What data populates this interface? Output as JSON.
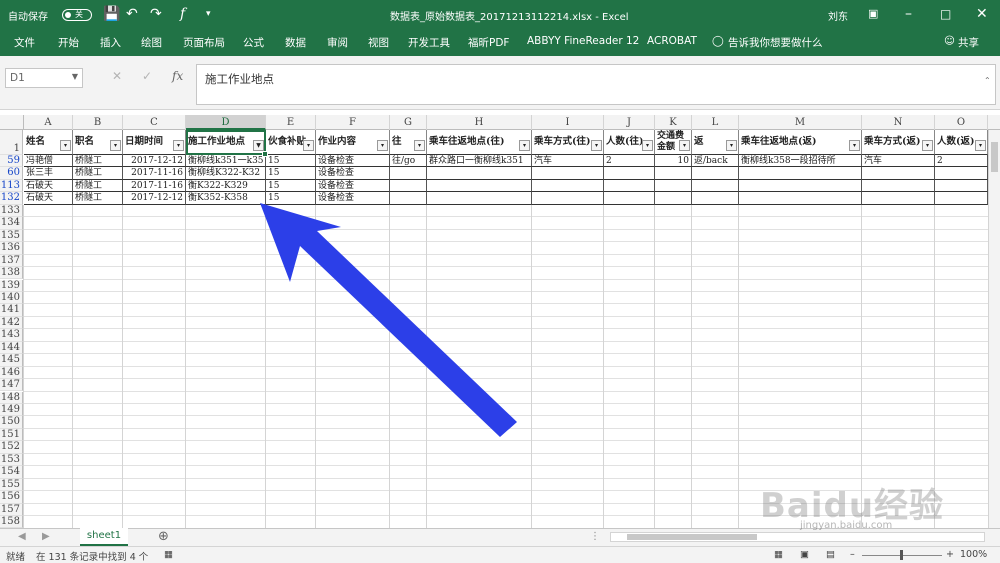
{
  "titlebar": {
    "autosave": "自动保存",
    "autosave_state": "关",
    "title": "数据表_原始数据表_20171213112214.xlsx  -  Excel",
    "user": "刘东"
  },
  "ribbon": {
    "tabs": [
      "文件",
      "开始",
      "插入",
      "绘图",
      "页面布局",
      "公式",
      "数据",
      "审阅",
      "视图",
      "开发工具",
      "福昕PDF",
      "ABBYY FineReader 12",
      "ACROBAT"
    ],
    "tell_me": "告诉我你想要做什么",
    "share": "共享"
  },
  "formula_bar": {
    "name_box": "D1",
    "fx": "fx",
    "content": "施工作业地点"
  },
  "columns": [
    "A",
    "B",
    "C",
    "D",
    "E",
    "F",
    "G",
    "H",
    "I",
    "J",
    "K",
    "L",
    "M",
    "N",
    "O"
  ],
  "header_row_number": "1",
  "headers": [
    "姓名",
    "职名",
    "日期时间",
    "施工作业地点",
    "伙食补贴",
    "作业内容",
    "往",
    "乘车往返地点(往)",
    "乘车方式(往)",
    "人数(往)",
    "交通费金额",
    "返",
    "乘车往返地点(返)",
    "乘车方式(返)",
    "人数(返)"
  ],
  "rows": [
    {
      "num": "59",
      "cells": [
        "冯艳僧",
        "桥隧工",
        "2017-12-12",
        "衡柳线k351一k35",
        "15",
        "设备检查",
        "往/go",
        "群众路口一衡柳线k351",
        "汽车",
        "2",
        "10",
        "返/back",
        "衡柳线k358一段招待所",
        "汽车",
        "2"
      ]
    },
    {
      "num": "60",
      "cells": [
        "张三丰",
        "桥隧工",
        "2017-11-16",
        "衡柳线K322-K32",
        "15",
        "设备检查",
        "",
        "",
        "",
        "",
        "",
        "",
        "",
        "",
        ""
      ]
    },
    {
      "num": "113",
      "cells": [
        "石破天",
        "桥隧工",
        "2017-11-16",
        "衡K322-K329",
        "15",
        "设备检查",
        "",
        "",
        "",
        "",
        "",
        "",
        "",
        "",
        ""
      ]
    },
    {
      "num": "132",
      "cells": [
        "石破天",
        "桥隧工",
        "2017-12-12",
        "衡K352-K358",
        "15",
        "设备检查",
        "",
        "",
        "",
        "",
        "",
        "",
        "",
        "",
        ""
      ]
    }
  ],
  "empty_rows": [
    "133",
    "134",
    "135",
    "136",
    "137",
    "138",
    "139",
    "140",
    "141",
    "142",
    "143",
    "144",
    "145",
    "146",
    "147",
    "148",
    "149",
    "150",
    "151",
    "152",
    "153",
    "154",
    "155",
    "156",
    "157",
    "158"
  ],
  "sheet_tab": "sheet1",
  "status": {
    "mode": "就绪",
    "message": "在 131 条记录中找到 4 个",
    "zoom": "100%"
  },
  "watermark": {
    "main": "Baidu经验",
    "url": "jingyan.baidu.com"
  },
  "colors": {
    "excel_green": "#217346",
    "arrow_blue": "#2c3fe8"
  }
}
